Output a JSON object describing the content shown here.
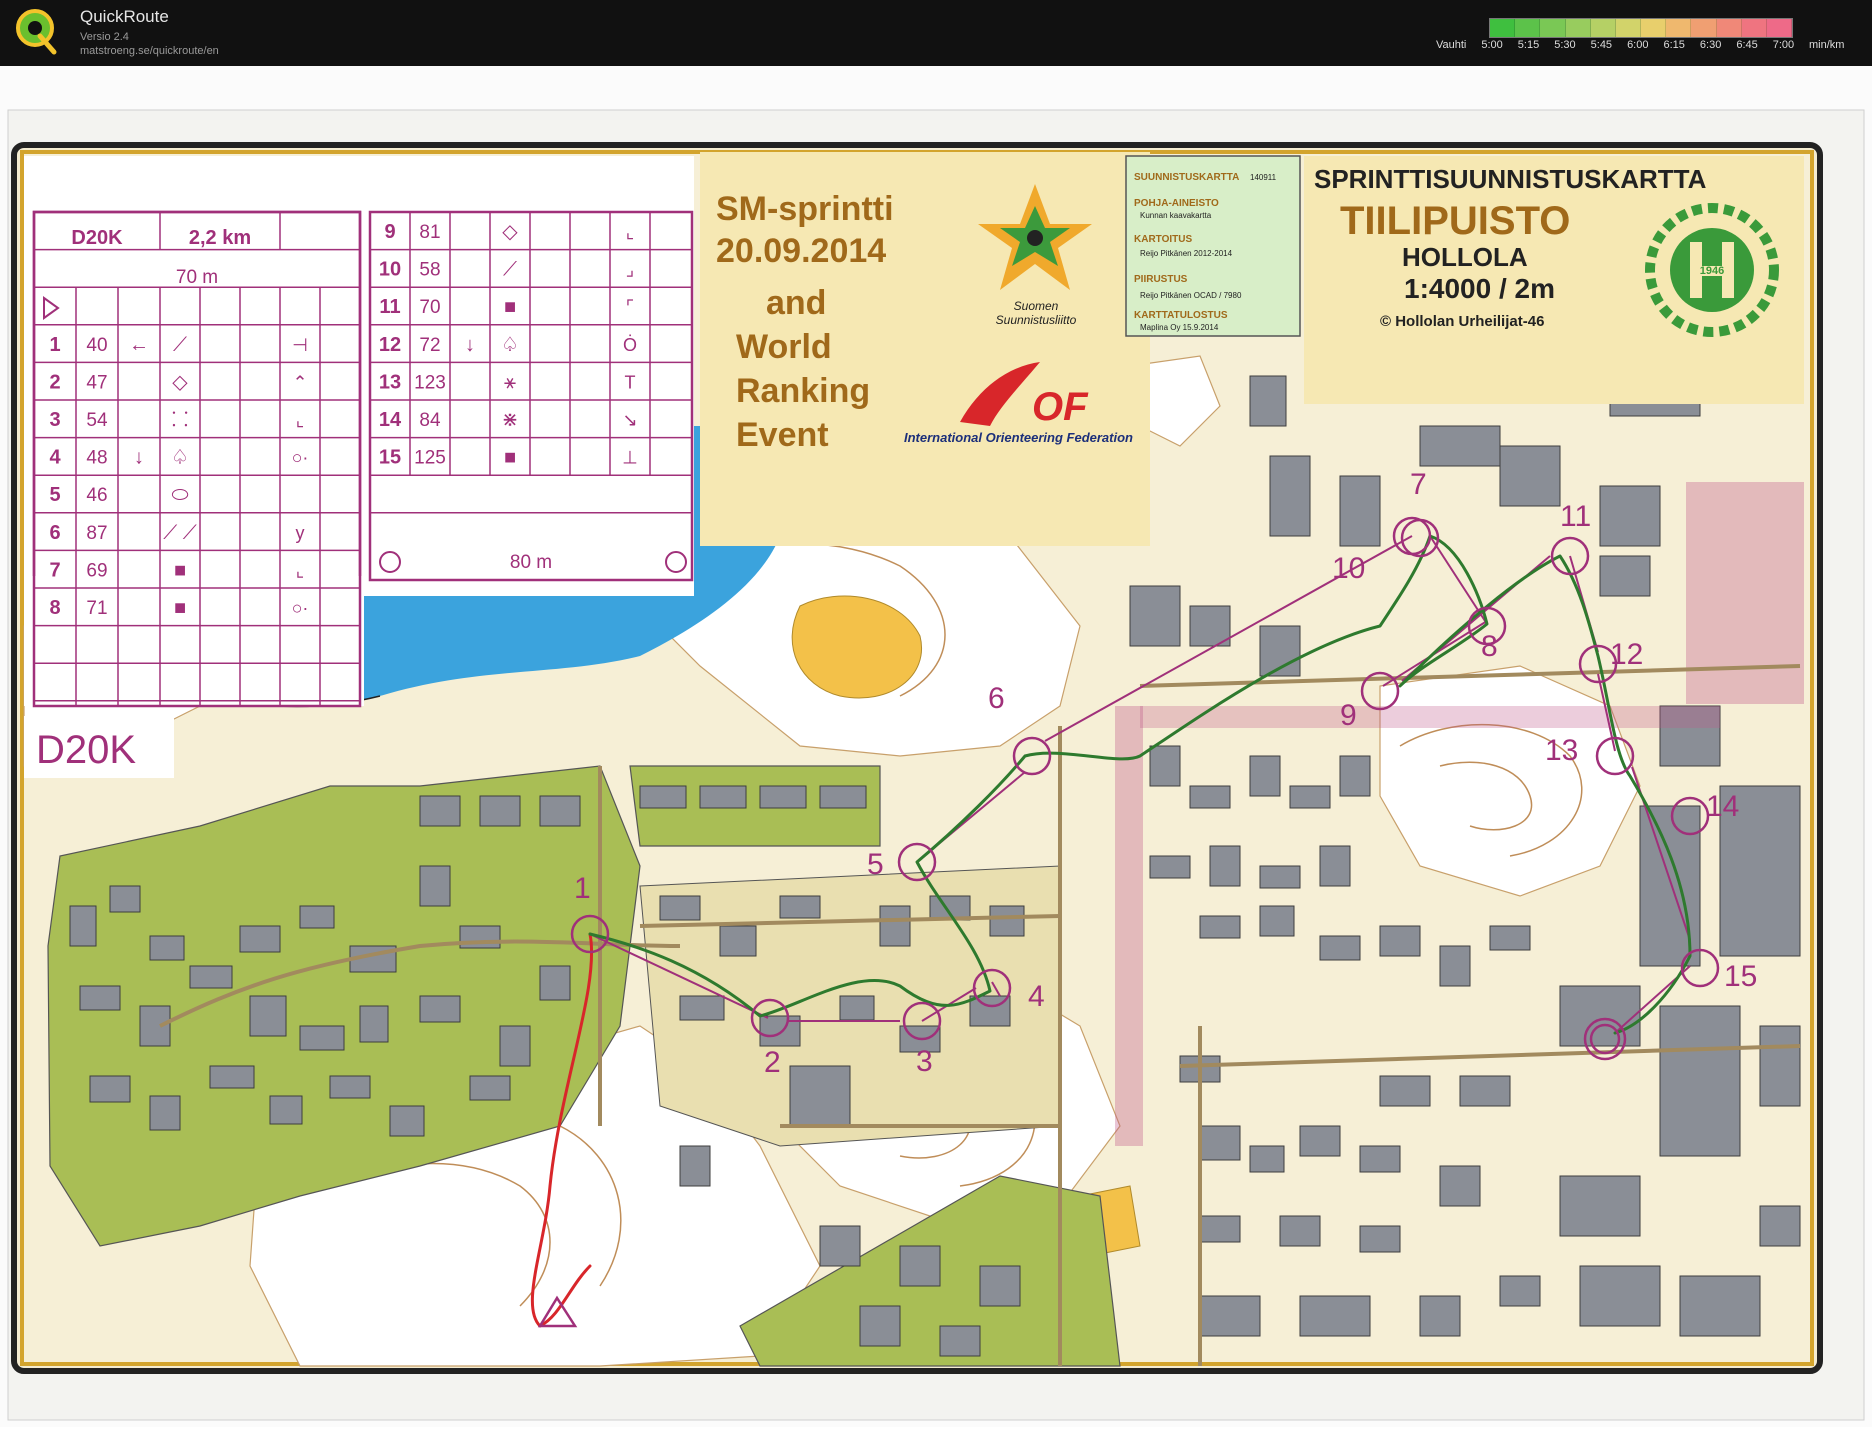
{
  "app": {
    "name": "QuickRoute",
    "version": "Versio 2.4",
    "url": "matstroeng.se/quickroute/en",
    "logo_letter": "Q"
  },
  "pace_legend": {
    "label": "Vauhti",
    "ticks": [
      "5:00",
      "5:15",
      "5:30",
      "5:45",
      "6:00",
      "6:15",
      "6:30",
      "6:45",
      "7:00"
    ],
    "unit": "min/km",
    "colors": [
      "#3fbf3f",
      "#5cc24a",
      "#7ac855",
      "#98cc5e",
      "#b5d065",
      "#d2d36a",
      "#e8cf6c",
      "#efb86e",
      "#f09f72",
      "#f08878",
      "#ef7480",
      "#ee6a88"
    ]
  },
  "event": {
    "line1": "SM-sprintti",
    "line2": "20.09.2014",
    "line3": "and",
    "line4": "World",
    "line5": "Ranking",
    "line6": "Event",
    "ssl_name_1": "Suomen",
    "ssl_name_2": "Suunnistusliitto",
    "iof_text": "OF",
    "iof_name": "International Orienteering Federation"
  },
  "map_info": {
    "map_label": "SUUNNISTUSKARTTA",
    "map_code": "140911",
    "base_label": "POHJA-AINEISTO",
    "base_value": "Kunnan kaavakartta",
    "survey_label": "KARTOITUS",
    "survey_value": "Reijo Pitkänen 2012-2014",
    "drawing_label": "PIIRUSTUS",
    "drawing_value": "Reijo Pitkänen OCAD / 7980",
    "print_label": "KARTTATULOSTUS",
    "print_value": "Maplina Oy 15.9.2014"
  },
  "map_title": {
    "type": "SPRINTTISUUNNISTUSKARTTA",
    "name": "TIILIPUISTO",
    "place": "HOLLOLA",
    "scale": "1:4000 / 2m",
    "copyright": "© Hollolan Urheilijat-46",
    "club_year": "1946"
  },
  "course_label": "D20K",
  "description_sheet": {
    "class": "D20K",
    "length": "2,2 km",
    "start_distance": "70 m",
    "finish_distance": "80 m",
    "left_controls": [
      {
        "n": "1",
        "code": "40",
        "dir": "←",
        "feature": "⟋",
        "pos": "⊣"
      },
      {
        "n": "2",
        "code": "47",
        "dir": "",
        "feature": "◇",
        "pos": "⌃"
      },
      {
        "n": "3",
        "code": "54",
        "dir": "",
        "feature": "⸬",
        "pos": "⌞"
      },
      {
        "n": "4",
        "code": "48",
        "dir": "↓",
        "feature": "♤",
        "pos": "○·"
      },
      {
        "n": "5",
        "code": "46",
        "dir": "",
        "feature": "⬭",
        "pos": ""
      },
      {
        "n": "6",
        "code": "87",
        "dir": "",
        "feature": "⟋ ⟋",
        "pos": "y"
      },
      {
        "n": "7",
        "code": "69",
        "dir": "",
        "feature": "■",
        "pos": "⌞"
      },
      {
        "n": "8",
        "code": "71",
        "dir": "",
        "feature": "■",
        "pos": "○·"
      }
    ],
    "right_controls": [
      {
        "n": "9",
        "code": "81",
        "dir": "",
        "feature": "◇",
        "pos": "⌞"
      },
      {
        "n": "10",
        "code": "58",
        "dir": "",
        "feature": "⟋",
        "pos": "⌟"
      },
      {
        "n": "11",
        "code": "70",
        "dir": "",
        "feature": "■",
        "pos": "⌜"
      },
      {
        "n": "12",
        "code": "72",
        "dir": "↓",
        "feature": "♤",
        "pos": "Ȯ"
      },
      {
        "n": "13",
        "code": "123",
        "dir": "",
        "feature": "⚹",
        "pos": "T"
      },
      {
        "n": "14",
        "code": "84",
        "dir": "",
        "feature": "⋇",
        "pos": "↘"
      },
      {
        "n": "15",
        "code": "125",
        "dir": "",
        "feature": "■",
        "pos": "⊥"
      }
    ]
  },
  "controls": [
    "1",
    "2",
    "3",
    "4",
    "5",
    "6",
    "7",
    "8",
    "9",
    "10",
    "11",
    "12",
    "13",
    "14",
    "15"
  ],
  "colors": {
    "course": "#a0307a",
    "title_brown": "#a0691a",
    "lake": "#3ba3dd",
    "urban": "#f6efd6",
    "forest": "#ffffff",
    "green_area": "#a9be55",
    "building": "#8a8e96",
    "route_green": "#2e7a2e",
    "route_red": "#d8262a"
  }
}
